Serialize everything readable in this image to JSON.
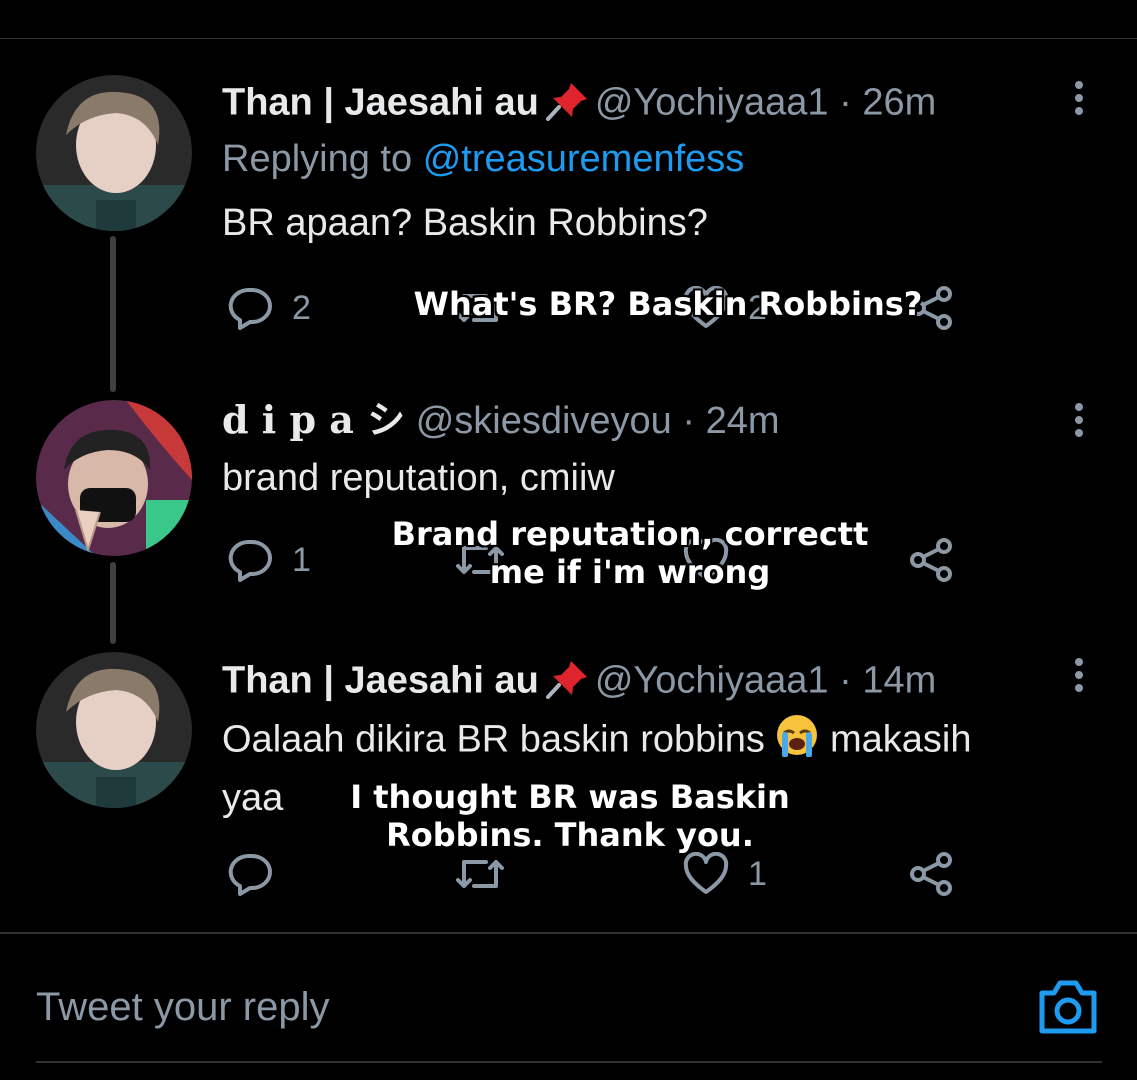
{
  "tweets": [
    {
      "name": "Than | Jaesahi au",
      "handle": "@Yochiyaaa1",
      "time": "· 26m",
      "replying_prefix": "Replying to",
      "replying_to": "@treasuremenfess",
      "text": "BR apaan? Baskin Robbins?",
      "reply_count": "2",
      "like_count": "2",
      "overlay": "What's BR? Baskin Robbins?"
    },
    {
      "name": "d i p a シ",
      "handle": "@skiesdiveyou",
      "time": "· 24m",
      "text": "brand reputation, cmiiw",
      "reply_count": "1",
      "overlay_line1": "Brand reputation, correctt",
      "overlay_line2": "me if i'm wrong"
    },
    {
      "name": "Than | Jaesahi au",
      "handle": "@Yochiyaaa1",
      "time": "· 14m",
      "text_line1a": "Oalaah dikira BR baskin robbins",
      "text_line1b": "makasih",
      "text_line2": "yaa",
      "like_count": "1",
      "overlay_line1": "I thought BR was Baskin",
      "overlay_line2": "Robbins. Thank you."
    }
  ],
  "composer": {
    "placeholder": "Tweet your reply"
  },
  "icons": {
    "pin": "pushpin-icon",
    "crying": "loudly-crying-face-icon",
    "reply": "reply-bubble-icon",
    "retweet": "retweet-icon",
    "like": "heart-icon",
    "share": "share-icon",
    "more": "more-vertical-icon",
    "camera": "camera-icon"
  },
  "colors": {
    "background": "#000000",
    "text": "#e7e9ea",
    "muted": "#8b98a5",
    "accent": "#1d9bf0"
  }
}
